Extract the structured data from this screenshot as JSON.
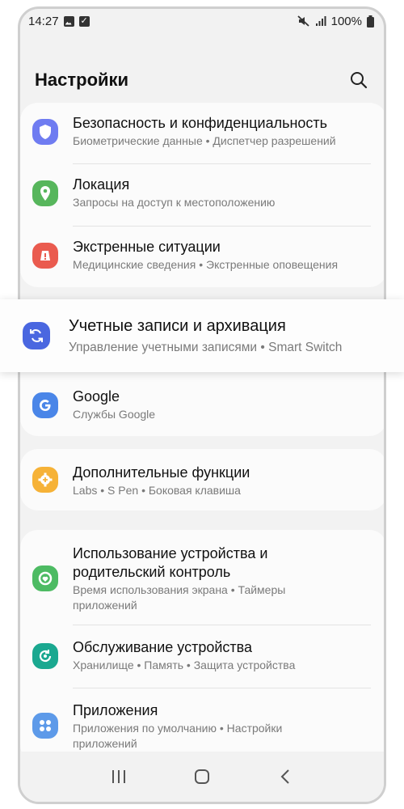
{
  "status_bar": {
    "time": "14:27",
    "battery": "100%",
    "icons": [
      "image-icon",
      "check-square-icon",
      "mute-icon",
      "signal-icon",
      "battery-icon"
    ]
  },
  "header": {
    "title": "Настройки",
    "search_icon": "search-icon"
  },
  "groups": [
    {
      "items": [
        {
          "title": "Безопасность и конфиденциальность",
          "subtitle": "Биометрические данные • Диспетчер разрешений",
          "icon": "shield-icon",
          "color": "#6f7cf1"
        },
        {
          "title": "Локация",
          "subtitle": "Запросы на доступ к местоположению",
          "icon": "location-pin-icon",
          "color": "#57b65c"
        },
        {
          "title": "Экстренные ситуации",
          "subtitle": "Медицинские сведения • Экстренные оповещения",
          "icon": "alert-icon",
          "color": "#ea5b4f"
        }
      ]
    },
    {
      "items": [
        {
          "title": "Учетные записи и архивация",
          "subtitle": "Управление учетными записями • Smart Switch",
          "icon": "sync-icon",
          "color": "#4a67e0"
        },
        {
          "title": "Google",
          "subtitle": "Службы Google",
          "icon": "google-icon",
          "color": "#4a86e8"
        }
      ]
    },
    {
      "items": [
        {
          "title": "Дополнительные функции",
          "subtitle": "Labs • S Pen • Боковая клавиша",
          "icon": "gear-plus-icon",
          "color": "#f6b237"
        }
      ]
    },
    {
      "items": [
        {
          "title": "Использование устройства и родительский контроль",
          "subtitle": "Время использования экрана • Таймеры приложений",
          "icon": "digital-wellbeing-icon",
          "color": "#4dbb63"
        },
        {
          "title": "Обслуживание устройства",
          "subtitle": "Хранилище • Память • Защита устройства",
          "icon": "device-care-icon",
          "color": "#1aa890"
        },
        {
          "title": "Приложения",
          "subtitle": "Приложения по умолчанию • Настройки приложений",
          "icon": "apps-grid-icon",
          "color": "#5d9ae9"
        }
      ]
    }
  ],
  "nav": {
    "recent": "recent-apps-icon",
    "home": "home-icon",
    "back": "back-icon"
  }
}
